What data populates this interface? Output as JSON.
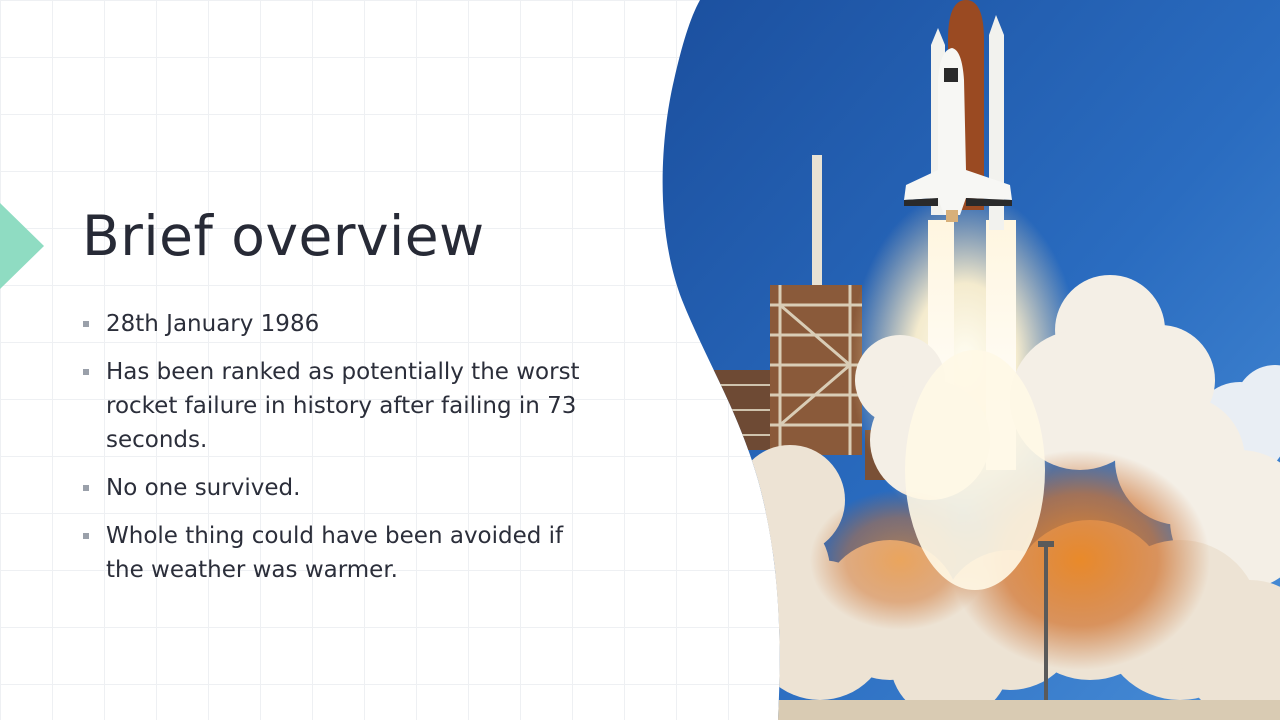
{
  "slide": {
    "title": "Brief overview",
    "bullets": [
      "28th January 1986",
      "Has been ranked as potentially the worst rocket failure in history after failing in 73 seconds.",
      "No one survived.",
      "Whole thing could have been avoided if the weather was warmer."
    ]
  },
  "colors": {
    "accent": "#8fdcc2",
    "title_text": "#272a36",
    "body_text": "#2b2e3a",
    "bullet_marker": "#9aa0aa",
    "sky": "#1e5fb0"
  },
  "photo": {
    "subject": "space-shuttle-launch-photo"
  }
}
